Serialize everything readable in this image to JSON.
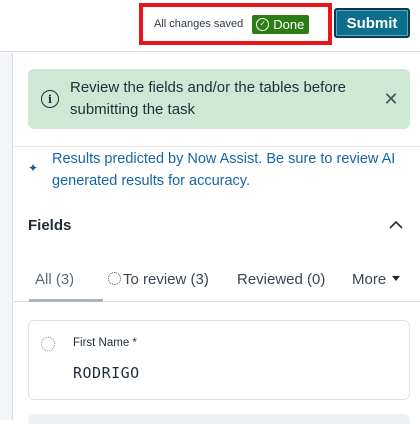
{
  "header": {
    "save_status": "All changes saved",
    "done_badge": "Done",
    "submit_label": "Submit"
  },
  "alert": {
    "message": "Review the fields and/or the tables before submitting the task",
    "icon": "info-icon",
    "close_icon": "close-icon"
  },
  "ai_notice": {
    "line1": "Results predicted by Now Assist. Be sure to review AI",
    "line2": "generated results for accuracy.",
    "icon": "sparkle-icon"
  },
  "fields_section": {
    "title": "Fields",
    "tabs": [
      {
        "label": "All (3)",
        "active": true
      },
      {
        "label": "To review (3)",
        "active": false
      },
      {
        "label": "Reviewed (0)",
        "active": false
      },
      {
        "label": "More",
        "active": false
      }
    ],
    "fields": [
      {
        "label": "First Name *",
        "value": "RODRIGO"
      }
    ]
  },
  "colors": {
    "accent": "#0e6f8c",
    "done_green": "#2e7d14",
    "alert_bg": "#cfe8d6",
    "link_blue": "#1565a8",
    "highlight_red": "#e8151b"
  }
}
